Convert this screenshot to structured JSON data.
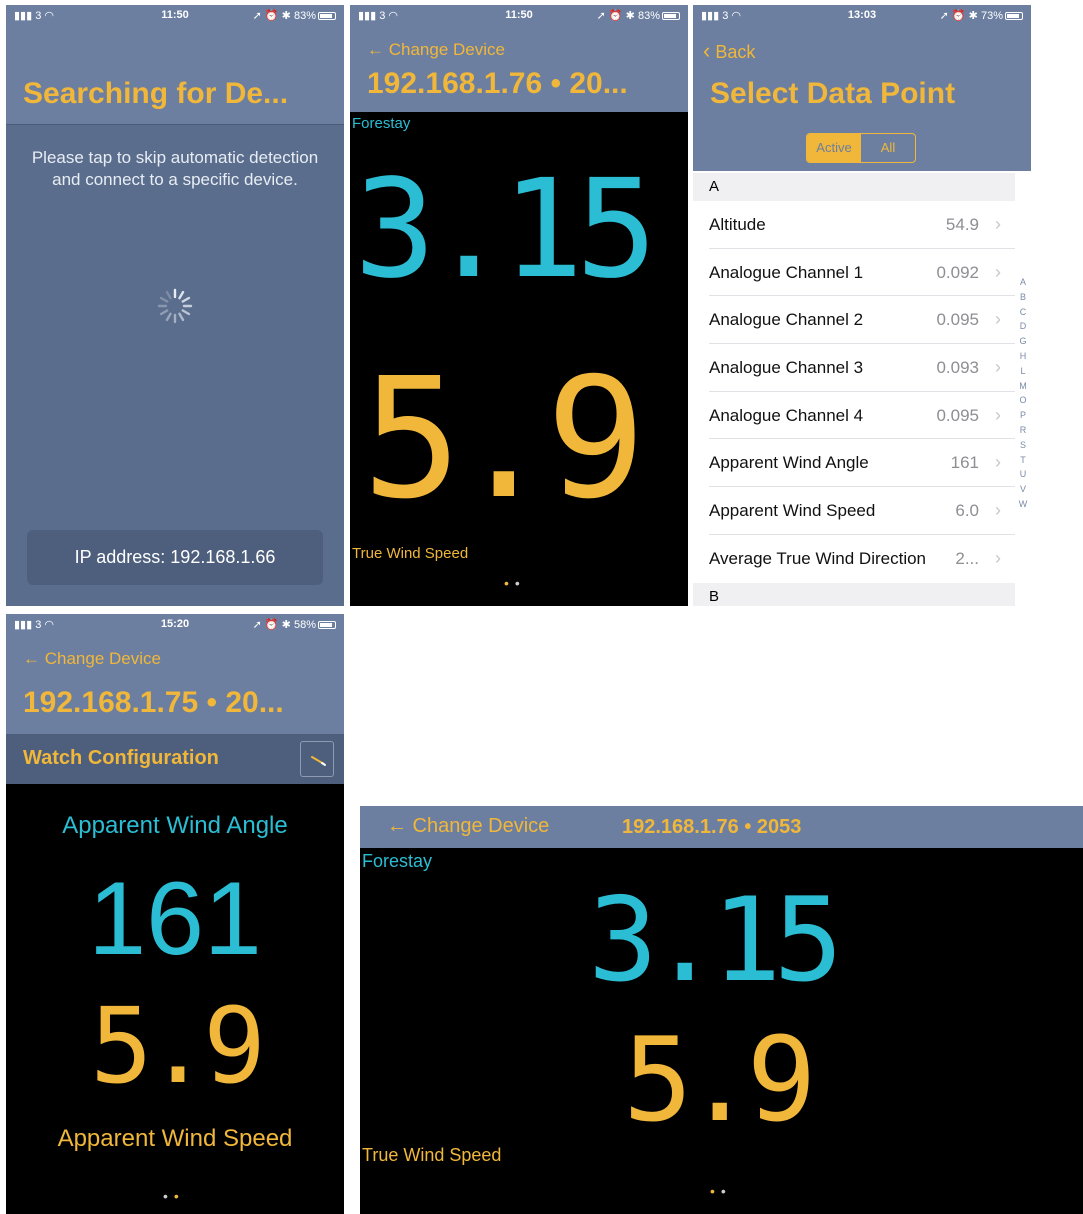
{
  "shot1": {
    "status": {
      "signal": "3",
      "time": "11:50",
      "battery": "83%"
    },
    "title": "Searching for De...",
    "hint": "Please tap to skip automatic detection and connect to a specific device.",
    "ip_button": "IP address: 192.168.1.66"
  },
  "shot2": {
    "status": {
      "signal": "3",
      "time": "11:50",
      "battery": "83%"
    },
    "back_label": "← Change Device",
    "device_title": "192.168.1.76 • 20...",
    "top_label": "Forestay",
    "top_value": "3.15",
    "bottom_value": "5.9",
    "bottom_label": "True Wind Speed",
    "page_dots": "••"
  },
  "shot3": {
    "status": {
      "signal": "3",
      "time": "13:03",
      "battery": "73%"
    },
    "back_label": "Back",
    "title": "Select Data Point",
    "segments": [
      "Active",
      "All"
    ],
    "section_a": "A",
    "section_b": "B",
    "rows": [
      {
        "label": "Altitude",
        "value": "54.9"
      },
      {
        "label": "Analogue Channel 1",
        "value": "0.092"
      },
      {
        "label": "Analogue Channel 2",
        "value": "0.095"
      },
      {
        "label": "Analogue Channel 3",
        "value": "0.093"
      },
      {
        "label": "Analogue Channel 4",
        "value": "0.095"
      },
      {
        "label": "Apparent Wind Angle",
        "value": "161"
      },
      {
        "label": "Apparent Wind Speed",
        "value": "6.0"
      },
      {
        "label": "Average True Wind Direction",
        "value": "2..."
      }
    ],
    "index_letters": [
      "A",
      "B",
      "C",
      "D",
      "G",
      "H",
      "L",
      "M",
      "O",
      "P",
      "R",
      "S",
      "T",
      "U",
      "V",
      "W"
    ]
  },
  "shot4": {
    "status": {
      "signal": "3",
      "time": "15:20",
      "battery": "58%"
    },
    "back_label": "← Change Device",
    "device_title": "192.168.1.75 • 20...",
    "watch_title": "Watch Configuration",
    "top_label": "Apparent Wind Angle",
    "top_value": "161",
    "bottom_value": "5.9",
    "bottom_label": "Apparent Wind Speed",
    "page_dots": "••"
  },
  "shot5": {
    "back_label": "← Change Device",
    "device_title": "192.168.1.76 • 2053",
    "top_label": "Forestay",
    "top_value": "3.15",
    "bottom_value": "5.9",
    "bottom_label": "True Wind Speed",
    "page_dots": "••"
  },
  "colors": {
    "accent": "#f0b73a",
    "cyan": "#2bbdd3",
    "header": "#6c7fa0",
    "background_dark": "#000000"
  }
}
